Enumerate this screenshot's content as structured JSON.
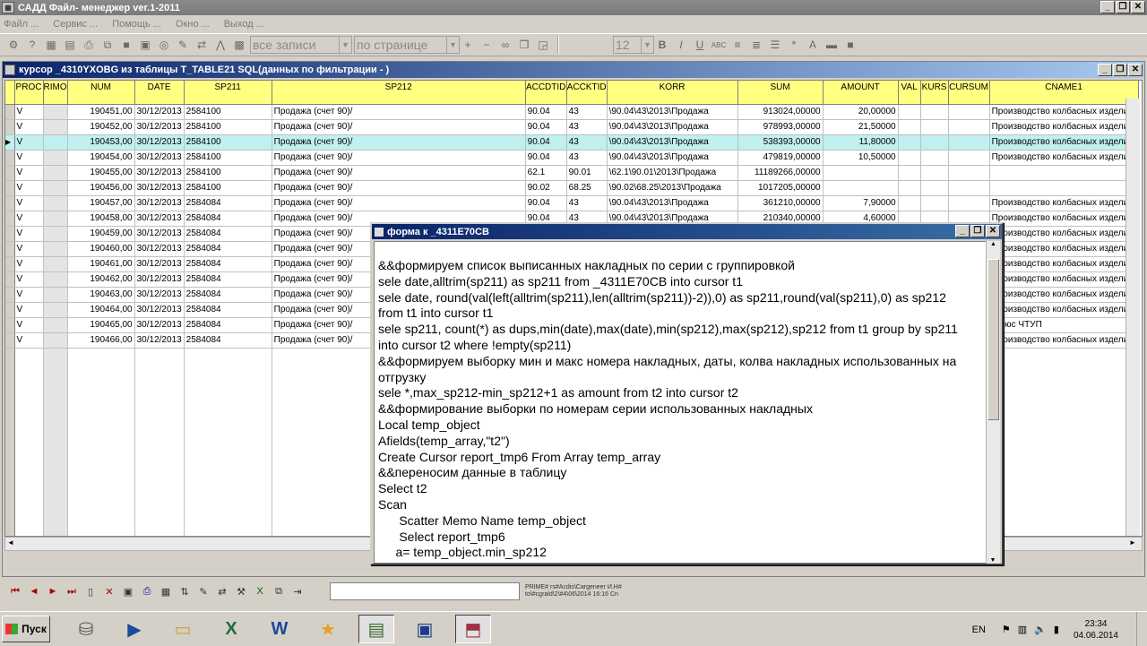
{
  "app": {
    "title": "САДД Файл- менеджер ver.1-2011",
    "window_buttons": [
      "_",
      "❐",
      "✕"
    ]
  },
  "menu": [
    "Файл ...",
    "Сервис ...",
    "Помощь ...",
    "Окно ...",
    "Выход ..."
  ],
  "toolbar": {
    "filter_combo": "все записи",
    "page_combo": "по странице",
    "font_size": "12"
  },
  "child_window": {
    "title": "курсор _4310YXOBG из таблицы T_TABLE21 SQL(данных по фильтрации - )"
  },
  "grid": {
    "columns": [
      "PROC",
      "RIMO",
      "NUM",
      "DATE",
      "SP211",
      "SP212",
      "ACCDTID",
      "ACCKTID",
      "KORR",
      "SUM",
      "AMOUNT",
      "VAL",
      "KURS",
      "CURSUM",
      "CNAME1"
    ],
    "rows": [
      {
        "proc": "V",
        "num": "190451,00",
        "date": "30/12/2013",
        "sp211": "2584100",
        "sp212": "Продажа (счет 90)/",
        "accdt": "90.04",
        "acckt": "43",
        "korr": "\\90.04\\43\\2013\\Продажа",
        "sum": "913024,00000",
        "amount": "20,00000",
        "cname": "Производство колбасных изделий"
      },
      {
        "proc": "V",
        "num": "190452,00",
        "date": "30/12/2013",
        "sp211": "2584100",
        "sp212": "Продажа (счет 90)/",
        "accdt": "90.04",
        "acckt": "43",
        "korr": "\\90.04\\43\\2013\\Продажа",
        "sum": "978993,00000",
        "amount": "21,50000",
        "cname": "Производство колбасных изделий"
      },
      {
        "proc": "V",
        "num": "190453,00",
        "date": "30/12/2013",
        "sp211": "2584100",
        "sp212": "Продажа (счет 90)/",
        "accdt": "90.04",
        "acckt": "43",
        "korr": "\\90.04\\43\\2013\\Продажа",
        "sum": "538393,00000",
        "amount": "11,80000",
        "cname": "Производство колбасных изделий"
      },
      {
        "proc": "V",
        "num": "190454,00",
        "date": "30/12/2013",
        "sp211": "2584100",
        "sp212": "Продажа (счет 90)/",
        "accdt": "90.04",
        "acckt": "43",
        "korr": "\\90.04\\43\\2013\\Продажа",
        "sum": "479819,00000",
        "amount": "10,50000",
        "cname": "Производство колбасных изделий"
      },
      {
        "proc": "V",
        "num": "190455,00",
        "date": "30/12/2013",
        "sp211": "2584100",
        "sp212": "Продажа (счет 90)/",
        "accdt": "62.1",
        "acckt": "90.01",
        "korr": "\\62.1\\90.01\\2013\\Продажа",
        "sum": "11189266,00000",
        "amount": "",
        "cname": ""
      },
      {
        "proc": "V",
        "num": "190456,00",
        "date": "30/12/2013",
        "sp211": "2584100",
        "sp212": "Продажа (счет 90)/",
        "accdt": "90.02",
        "acckt": "68.25",
        "korr": "\\90.02\\68.25\\2013\\Продажа",
        "sum": "1017205,00000",
        "amount": "",
        "cname": ""
      },
      {
        "proc": "V",
        "num": "190457,00",
        "date": "30/12/2013",
        "sp211": "2584084",
        "sp212": "Продажа (счет 90)/",
        "accdt": "90.04",
        "acckt": "43",
        "korr": "\\90.04\\43\\2013\\Продажа",
        "sum": "361210,00000",
        "amount": "7,90000",
        "cname": "Производство колбасных изделий"
      },
      {
        "proc": "V",
        "num": "190458,00",
        "date": "30/12/2013",
        "sp211": "2584084",
        "sp212": "Продажа (счет 90)/",
        "accdt": "90.04",
        "acckt": "43",
        "korr": "\\90.04\\43\\2013\\Продажа",
        "sum": "210340,00000",
        "amount": "4,60000",
        "cname": "Производство колбасных изделий"
      },
      {
        "proc": "V",
        "num": "190459,00",
        "date": "30/12/2013",
        "sp211": "2584084",
        "sp212": "Продажа (счет 90)/",
        "accdt": "",
        "acckt": "",
        "korr": "",
        "sum": "",
        "amount": "",
        "cname": "Производство колбасных изделий"
      },
      {
        "proc": "V",
        "num": "190460,00",
        "date": "30/12/2013",
        "sp211": "2584084",
        "sp212": "Продажа (счет 90)/",
        "accdt": "",
        "acckt": "",
        "korr": "",
        "sum": "",
        "amount": "",
        "cname": "Производство колбасных изделий"
      },
      {
        "proc": "V",
        "num": "190461,00",
        "date": "30/12/2013",
        "sp211": "2584084",
        "sp212": "Продажа (счет 90)/",
        "accdt": "",
        "acckt": "",
        "korr": "",
        "sum": "",
        "amount": "",
        "cname": "Производство колбасных изделий"
      },
      {
        "proc": "V",
        "num": "190462,00",
        "date": "30/12/2013",
        "sp211": "2584084",
        "sp212": "Продажа (счет 90)/",
        "accdt": "",
        "acckt": "",
        "korr": "",
        "sum": "",
        "amount": "",
        "cname": "Производство колбасных изделий"
      },
      {
        "proc": "V",
        "num": "190463,00",
        "date": "30/12/2013",
        "sp211": "2584084",
        "sp212": "Продажа (счет 90)/",
        "accdt": "",
        "acckt": "",
        "korr": "",
        "sum": "",
        "amount": "",
        "cname": "Производство колбасных изделий"
      },
      {
        "proc": "V",
        "num": "190464,00",
        "date": "30/12/2013",
        "sp211": "2584084",
        "sp212": "Продажа (счет 90)/",
        "accdt": "",
        "acckt": "",
        "korr": "",
        "sum": "",
        "amount": "",
        "cname": "Производство колбасных изделий"
      },
      {
        "proc": "V",
        "num": "190465,00",
        "date": "30/12/2013",
        "sp211": "2584084",
        "sp212": "Продажа (счет 90)/",
        "accdt": "",
        "acckt": "",
        "korr": "",
        "sum": "",
        "amount": "",
        "cname": "-плюс ЧТУП"
      },
      {
        "proc": "V",
        "num": "190466,00",
        "date": "30/12/2013",
        "sp211": "2584084",
        "sp212": "Продажа (счет 90)/",
        "accdt": "",
        "acckt": "",
        "korr": "",
        "sum": "",
        "amount": "",
        "cname": "Производство колбасных изделий"
      }
    ]
  },
  "memo": {
    "title": "форма к _4311E70CB",
    "lines": [
      "&&формируем список выписанных накладных по серии с группировкой",
      "sele date,alltrim(sp211) as sp211 from _4311E70CB into cursor t1",
      "sele date, round(val(left(alltrim(sp211),len(alltrim(sp211))-2)),0) as sp211,round(val(sp211),0) as sp212",
      "from t1 into cursor t1",
      "sele sp211, count(*) as dups,min(date),max(date),min(sp212),max(sp212),sp212 from t1 group by sp211",
      "into cursor t2 where !empty(sp211)",
      "&&формируем выборку мин и макс номера накладных, даты, колва накладных использованных на",
      "отгрузку",
      "sele *,max_sp212-min_sp212+1 as amount from t2 into cursor t2",
      "&&формирование выборки по номерам серии использованных накладных",
      "Local temp_object",
      "Afields(temp_array,\"t2\")",
      "Create Cursor report_tmp6 From Array temp_array",
      "&&переносим данные в таблицу",
      "Select t2",
      "Scan",
      "      Scatter Memo Name temp_object",
      "      Select report_tmp6",
      "     a= temp_object.min_sp212"
    ]
  },
  "statusbar": {
    "line1": "PRIME# rs#Acdis\\Cargeneer И.Н#",
    "line2": "to\\#cgrald\\2\\#4\\06\\2014 16:16 Cn"
  },
  "taskbar": {
    "start_label": "Пуск",
    "lang": "EN",
    "time": "23:34",
    "date": "04.06.2014",
    "tasks": [
      "network",
      "powershell",
      "explorer",
      "excel",
      "word",
      "browser",
      "books",
      "save-disk",
      "app"
    ]
  }
}
